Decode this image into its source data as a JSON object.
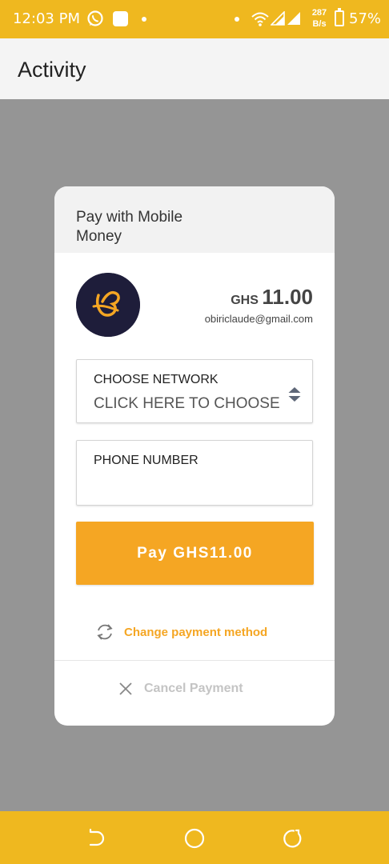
{
  "status_bar": {
    "time": "12:03 PM",
    "speed_value": "287",
    "speed_unit": "B/s",
    "battery": "57%",
    "icons": [
      "whatsapp-icon",
      "notification-square-icon",
      "wifi-icon",
      "signal-icon",
      "battery-icon"
    ]
  },
  "app_bar": {
    "title": "Activity"
  },
  "dialog": {
    "title": "Pay with Mobile Money",
    "currency": "GHS",
    "amount": "11.00",
    "email": "obiriclaude@gmail.com",
    "network": {
      "label": "CHOOSE NETWORK",
      "value": "CLICK HERE TO CHOOSE"
    },
    "phone": {
      "label": "PHONE NUMBER",
      "value": ""
    },
    "pay_button": "Pay GHS11.00",
    "change_method": "Change payment method",
    "cancel": "Cancel Payment"
  },
  "colors": {
    "status_bar": "#efb81f",
    "accent": "#f5a623",
    "overlay": "#959595",
    "logo_bg": "#1e1d3a",
    "cancel_text": "#c4c4c4"
  },
  "nav_bar": {
    "icons": [
      "back-icon",
      "home-icon",
      "recents-icon"
    ]
  }
}
